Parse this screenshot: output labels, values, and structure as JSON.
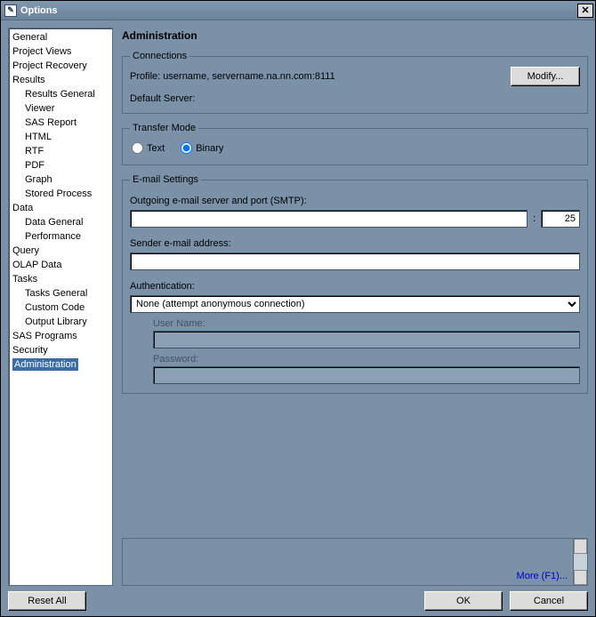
{
  "window": {
    "title": "Options"
  },
  "sidebar": {
    "items": [
      {
        "label": "General",
        "indent": false
      },
      {
        "label": "Project Views",
        "indent": false
      },
      {
        "label": "Project Recovery",
        "indent": false
      },
      {
        "label": "Results",
        "indent": false
      },
      {
        "label": "Results General",
        "indent": true
      },
      {
        "label": "Viewer",
        "indent": true
      },
      {
        "label": "SAS Report",
        "indent": true
      },
      {
        "label": "HTML",
        "indent": true
      },
      {
        "label": "RTF",
        "indent": true
      },
      {
        "label": "PDF",
        "indent": true
      },
      {
        "label": "Graph",
        "indent": true
      },
      {
        "label": "Stored Process",
        "indent": true
      },
      {
        "label": "Data",
        "indent": false
      },
      {
        "label": "Data General",
        "indent": true
      },
      {
        "label": "Performance",
        "indent": true
      },
      {
        "label": "Query",
        "indent": false
      },
      {
        "label": "OLAP Data",
        "indent": false
      },
      {
        "label": "Tasks",
        "indent": false
      },
      {
        "label": "Tasks General",
        "indent": true
      },
      {
        "label": "Custom Code",
        "indent": true
      },
      {
        "label": "Output Library",
        "indent": true
      },
      {
        "label": "SAS Programs",
        "indent": false
      },
      {
        "label": "Security",
        "indent": false
      },
      {
        "label": "Administration",
        "indent": false,
        "selected": true
      }
    ]
  },
  "page": {
    "title": "Administration",
    "connections": {
      "legend": "Connections",
      "profile_label": "Profile: username, servername.na.nn.com:8111",
      "modify_label": "Modify...",
      "default_server_label": "Default Server:"
    },
    "transfer": {
      "legend": "Transfer Mode",
      "text_label": "Text",
      "binary_label": "Binary",
      "selected": "binary"
    },
    "email": {
      "legend": "E-mail Settings",
      "smtp_label": "Outgoing e-mail server and port (SMTP):",
      "smtp_value": "",
      "port_value": "25",
      "sender_label": "Sender e-mail address:",
      "sender_value": "",
      "auth_label": "Authentication:",
      "auth_value": "None (attempt anonymous connection)",
      "username_label": "User Name:",
      "username_value": "",
      "password_label": "Password:",
      "password_value": ""
    },
    "more_label": "More (F1)..."
  },
  "footer": {
    "reset_label": "Reset All",
    "ok_label": "OK",
    "cancel_label": "Cancel"
  }
}
